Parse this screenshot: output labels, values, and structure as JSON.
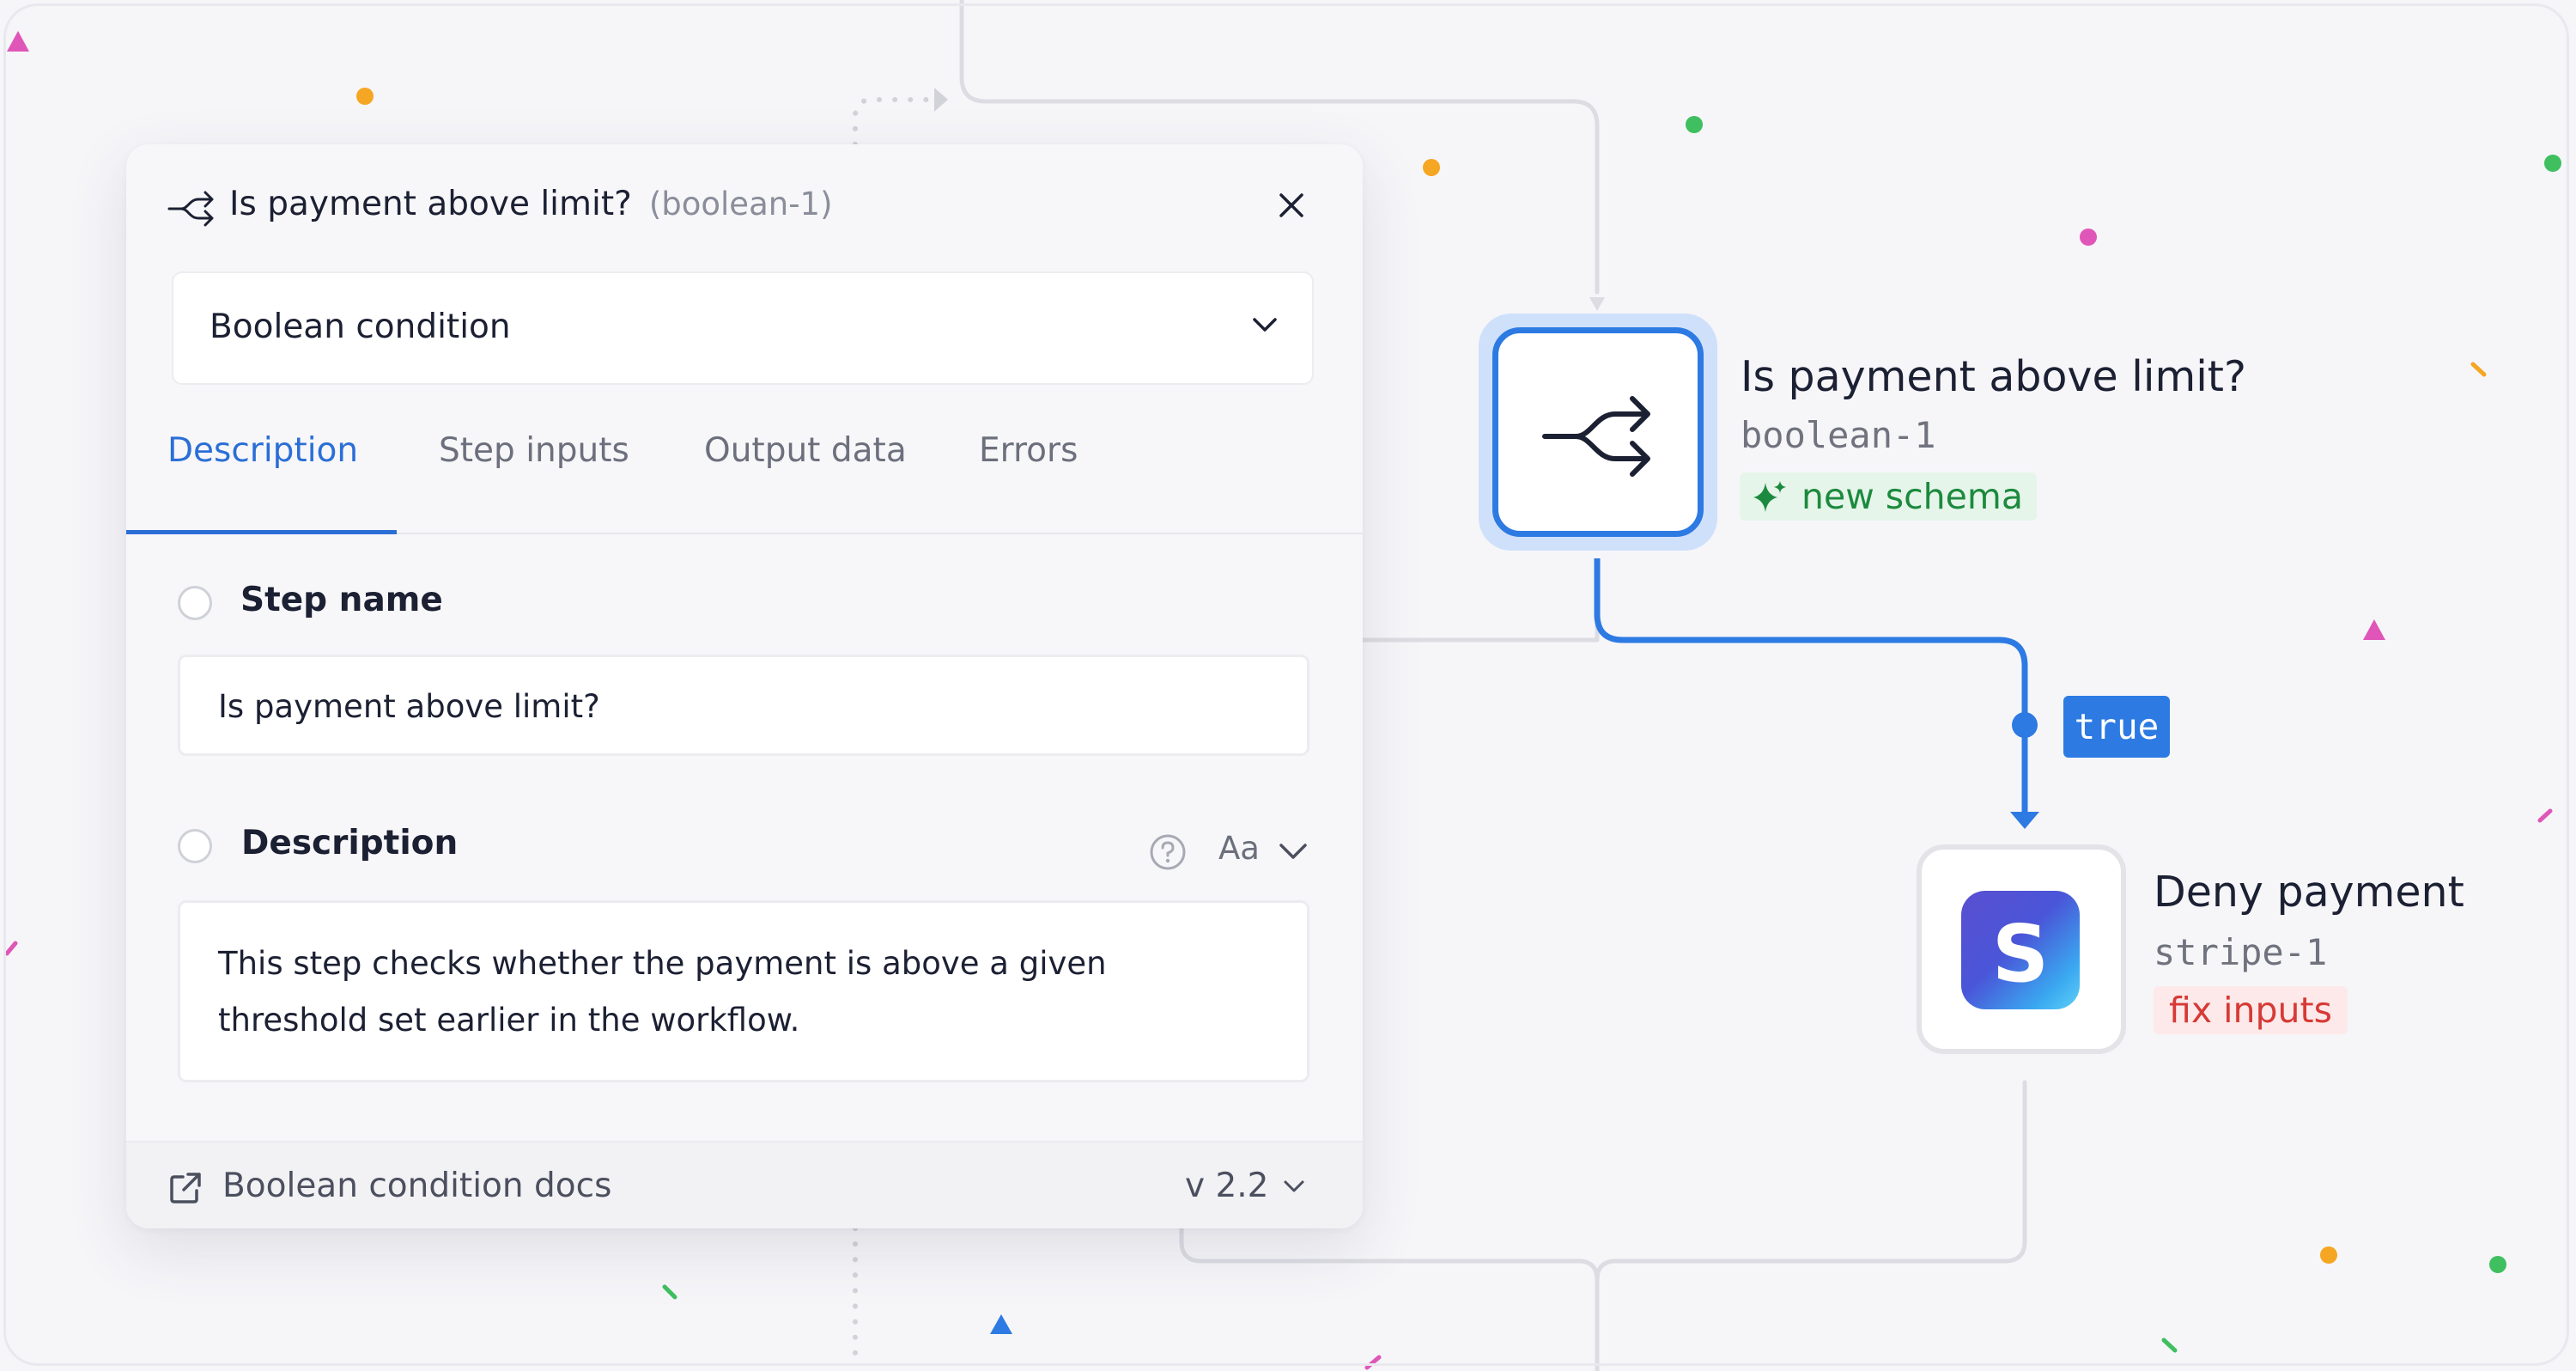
{
  "panel": {
    "title": "Is payment above limit?",
    "title_id": "(boolean-1)",
    "step_type": "Boolean condition",
    "tabs": [
      {
        "label": "Description",
        "active": true
      },
      {
        "label": "Step inputs",
        "active": false
      },
      {
        "label": "Output data",
        "active": false
      },
      {
        "label": "Errors",
        "active": false
      }
    ],
    "step_name": {
      "label": "Step name",
      "value": "Is payment above limit?"
    },
    "description": {
      "label": "Description",
      "format_toggle": "Aa",
      "value": "This step checks whether the payment is above a given threshold set earlier in the workflow."
    },
    "footer": {
      "docs_link": "Boolean condition docs",
      "version": "v 2.2"
    }
  },
  "canvas": {
    "condition_node": {
      "title": "Is payment above limit?",
      "id": "boolean-1",
      "badge": "new schema",
      "icon": "branch-icon"
    },
    "edge_label": "true",
    "stripe_node": {
      "title": "Deny payment",
      "id": "stripe-1",
      "badge": "fix inputs",
      "logo_letter": "S"
    }
  },
  "colors": {
    "accent": "#2d7ae3",
    "success": "#1c8a3e",
    "error": "#d63a36"
  }
}
